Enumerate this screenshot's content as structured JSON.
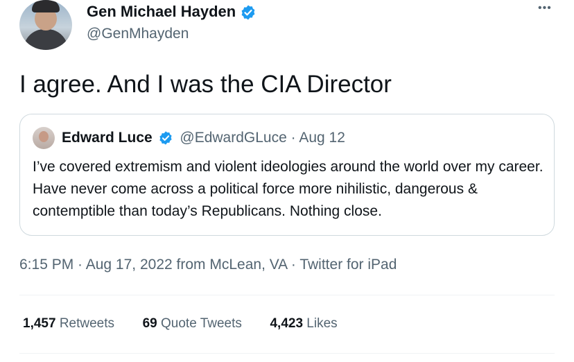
{
  "author": {
    "name": "Gen Michael Hayden",
    "handle": "@GenMhayden",
    "verified_color": "#1d9bf0"
  },
  "menu": {
    "more_label": "•••"
  },
  "tweet": {
    "text": "I agree.  And I was the CIA Director"
  },
  "quoted_tweet": {
    "name": "Edward Luce",
    "handle": "@EdwardGLuce",
    "separator": " · ",
    "date": "Aug 12",
    "text": "I’ve covered extremism and violent ideologies around the world over my career. Have never come across a political force more nihilistic, dangerous & contemptible than today’s Republicans. Nothing close."
  },
  "meta": {
    "time": "6:15 PM",
    "sep1": " · ",
    "date": "Aug 17, 2022",
    "location": " from McLean, VA",
    "sep2": " · ",
    "source": "Twitter for iPad"
  },
  "stats": {
    "retweets_count": "1,457",
    "retweets_label": " Retweets",
    "quotes_count": "69",
    "quotes_label": " Quote Tweets",
    "likes_count": "4,423",
    "likes_label": " Likes"
  }
}
